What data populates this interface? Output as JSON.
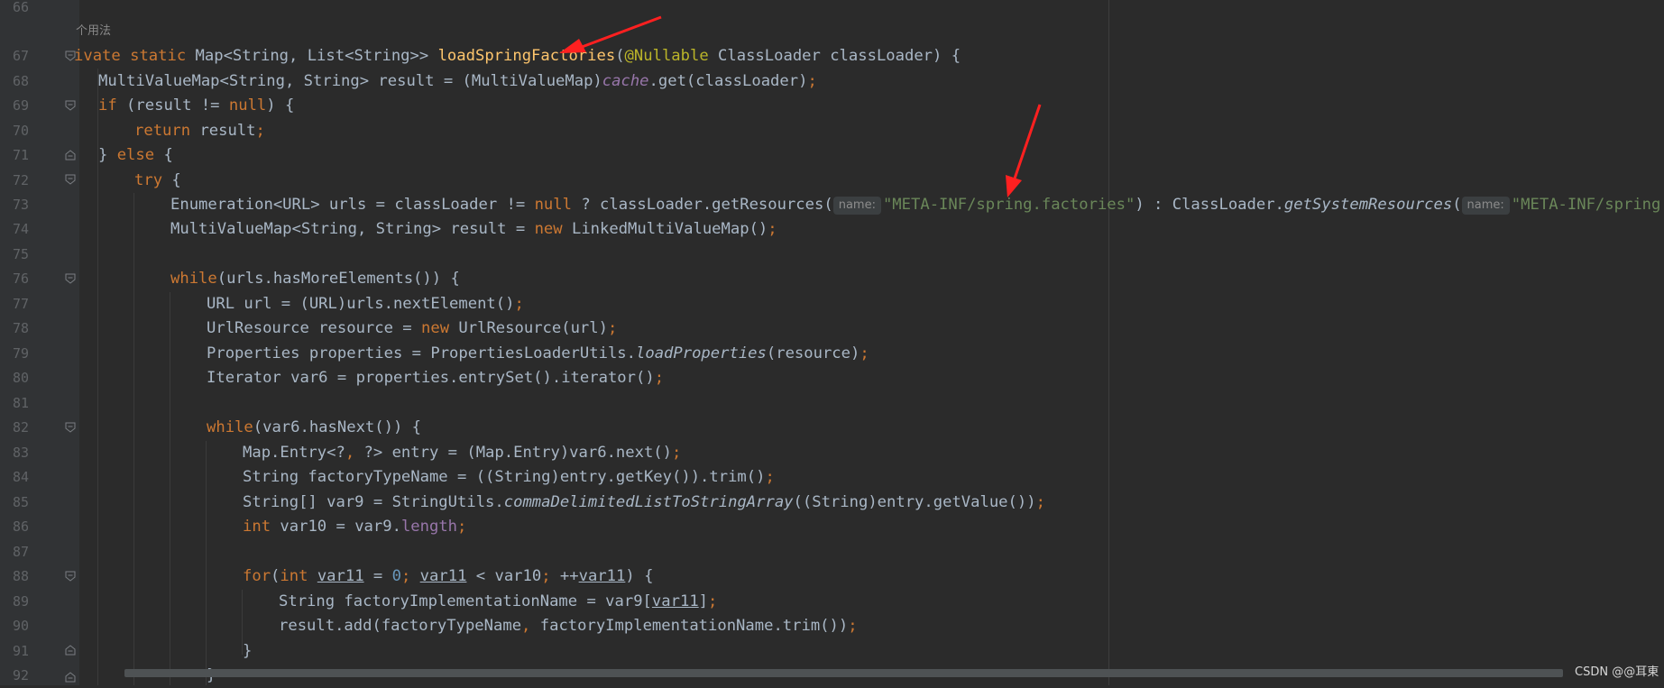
{
  "usage_hint": "个用法",
  "line_numbers": [
    "66",
    "67",
    "68",
    "69",
    "70",
    "71",
    "72",
    "73",
    "74",
    "75",
    "76",
    "77",
    "78",
    "79",
    "80",
    "81",
    "82",
    "83",
    "84",
    "85",
    "86",
    "87",
    "88",
    "89",
    "90",
    "91",
    "92"
  ],
  "code": {
    "l67": {
      "a": "ivate ",
      "b": "static ",
      "c": "Map<String, List<String>> ",
      "d": "loadSpringFactories",
      "e": "(",
      "f": "@Nullable ",
      "g": "ClassLoader classLoader) {"
    },
    "l68": {
      "a": "MultiValueMap<String, String> result = (MultiValueMap)",
      "b": "cache",
      ".": ".get(classLoader)",
      "c": ".get(classLoader)",
      "d": ";"
    },
    "l69": {
      "a": "if ",
      "b": "(result != ",
      "c": "null",
      "d": ") {"
    },
    "l70": {
      "a": "return ",
      "b": "result",
      "c": ";"
    },
    "l71": {
      "a": "} ",
      "b": "else ",
      "c": "{"
    },
    "l72": {
      "a": "try ",
      "b": "{"
    },
    "l73": {
      "a": "Enumeration<URL> urls = classLoader != ",
      "b": "null ",
      "c": "? classLoader.getResources(",
      "hint1": "name:",
      "d": "\"META-INF/spring.factories\"",
      "e": ") : ClassLoader.",
      "f": "getSystemResources",
      "g": "(",
      "hint2": "name:",
      "h": "\"META-INF/spring.fact"
    },
    "l74": {
      "a": "MultiValueMap<String, String> result = ",
      "b": "new ",
      "c": "LinkedMultiValueMap()",
      "d": ";"
    },
    "l76": {
      "a": "while",
      "b": "(urls.hasMoreElements()) {"
    },
    "l77": {
      "a": "URL url = (URL)urls.nextElement()",
      "b": ";"
    },
    "l78": {
      "a": "UrlResource resource = ",
      "b": "new ",
      "c": "UrlResource(url)",
      "d": ";"
    },
    "l79": {
      "a": "Properties properties = PropertiesLoaderUtils.",
      "b": "loadProperties",
      "c": "(resource)",
      "d": ";"
    },
    "l80": {
      "a": "Iterator var6 = properties.entrySet().iterator()",
      "b": ";"
    },
    "l82": {
      "a": "while",
      "b": "(var6.hasNext()) {"
    },
    "l83": {
      "a": "Map.Entry<?",
      "b": ", ",
      "c": "?> entry = (Map.Entry)var6.next()",
      "d": ";"
    },
    "l84": {
      "a": "String factoryTypeName = ((String)entry.getKey()).trim()",
      "b": ";"
    },
    "l85": {
      "a": "String[] var9 = StringUtils.",
      "b": "commaDelimitedListToStringArray",
      "c": "((String)entry.getValue())",
      "d": ";"
    },
    "l86": {
      "a": "int ",
      "b": "var10 = var9.",
      "c": "length",
      "d": ";"
    },
    "l88": {
      "a": "for",
      "b": "(",
      "c": "int ",
      "d": "var11",
      "e": " = ",
      "f": "0",
      "g": "; ",
      "h": "var11",
      "i": " < var10",
      "j": "; ",
      "k": "++",
      "l": "var11",
      "m": ") {"
    },
    "l89": {
      "a": "String factoryImplementationName = var9[",
      "b": "var11",
      "c": "]",
      "d": ";"
    },
    "l90": {
      "a": "result.add(factoryTypeName",
      "b": ", ",
      "c": "factoryImplementationName.trim())",
      "d": ";"
    },
    "l91": {
      "a": "}"
    },
    "l92": {
      "a": "}"
    }
  },
  "watermark": "CSDN @@耳東",
  "colors": {
    "background": "#2b2b2b",
    "keyword": "#cc7832",
    "method_decl": "#ffc66d",
    "annotation": "#bbb529",
    "string": "#6a8759",
    "number": "#6897bb",
    "field": "#9876aa",
    "default_text": "#a9b7c6",
    "arrow": "#ff2020"
  },
  "annotations": [
    {
      "icon": "red-arrow-icon",
      "points_to": "loadSpringFactories"
    },
    {
      "icon": "red-arrow-icon",
      "points_to": "META-INF/spring.factories"
    }
  ]
}
